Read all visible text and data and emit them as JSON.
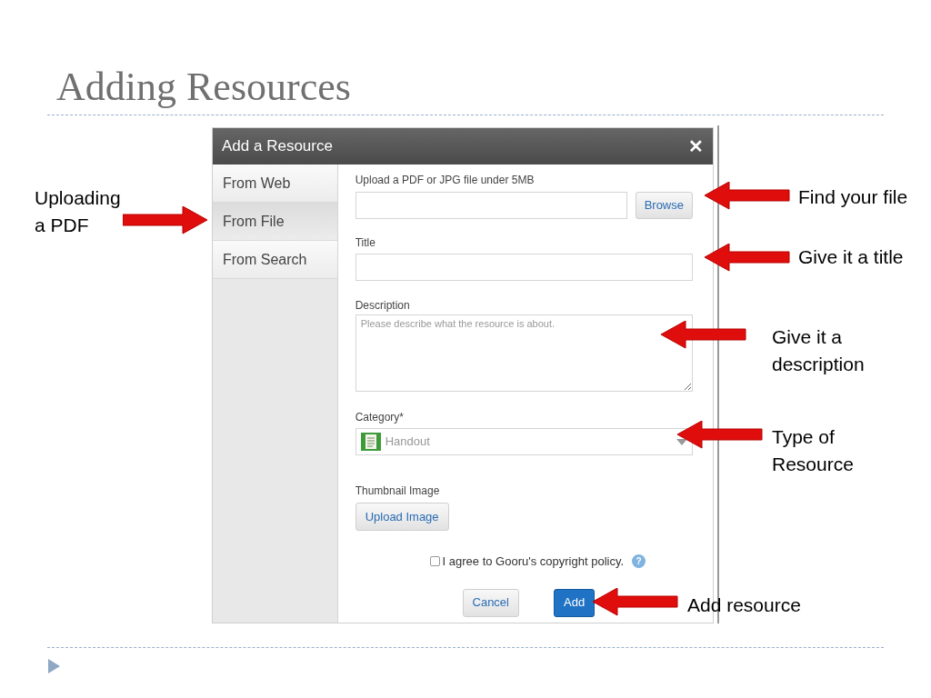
{
  "slide": {
    "title": "Adding Resources"
  },
  "dialog": {
    "title": "Add a Resource",
    "close": "✕",
    "tabs": [
      {
        "label": "From Web",
        "selected": false
      },
      {
        "label": "From File",
        "selected": true
      },
      {
        "label": "From Search",
        "selected": false
      }
    ],
    "upload": {
      "label": "Upload a PDF or JPG file under 5MB",
      "button": "Browse"
    },
    "title_field": {
      "label": "Title"
    },
    "description": {
      "label": "Description",
      "placeholder": "Please describe what the resource is about."
    },
    "category": {
      "label": "Category*",
      "value": "Handout"
    },
    "thumbnail": {
      "label": "Thumbnail Image",
      "button": "Upload Image"
    },
    "agree": {
      "label": "I agree to Gooru's copyright policy.",
      "checked": false,
      "help": "?"
    },
    "buttons": [
      {
        "label": "Cancel",
        "kind": "secondary"
      },
      {
        "label": "Add",
        "kind": "primary"
      }
    ]
  },
  "callouts": [
    {
      "text": "Uploading a PDF",
      "kind": "right"
    },
    {
      "text": "Find your file",
      "kind": "left"
    },
    {
      "text": "Give it a title",
      "kind": "left"
    },
    {
      "text": "Give it a description",
      "kind": "left"
    },
    {
      "text": "Type of Resource",
      "kind": "left"
    },
    {
      "text": "Add resource",
      "kind": "left"
    }
  ]
}
